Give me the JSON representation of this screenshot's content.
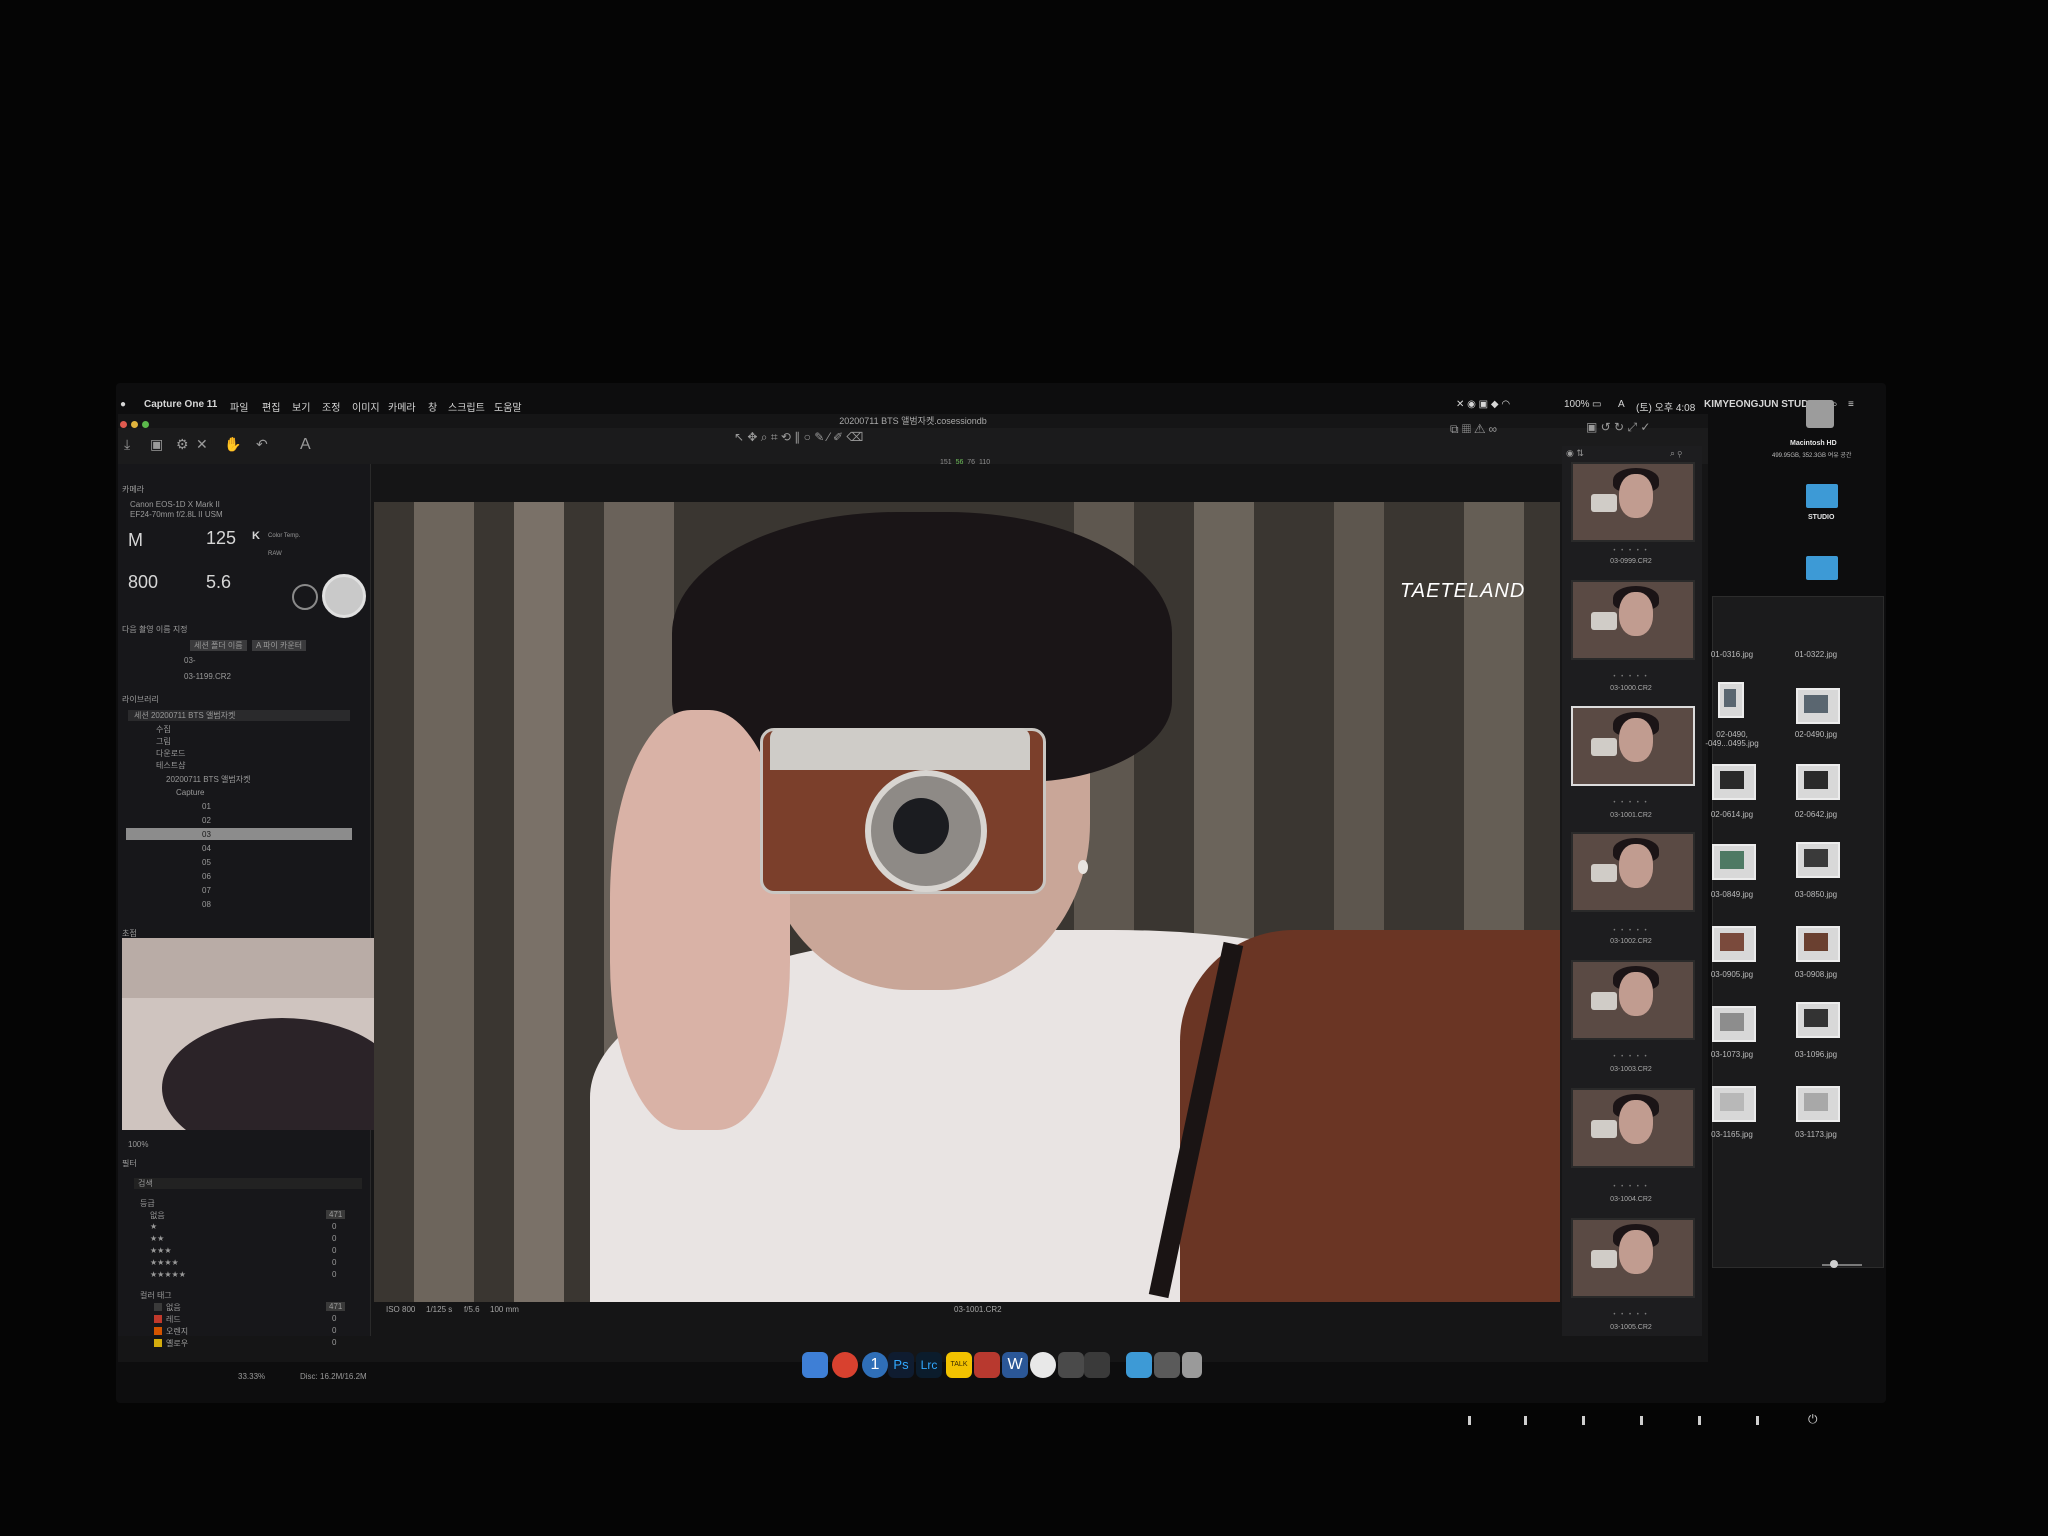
{
  "menubar": {
    "app_name": "Capture One 11",
    "items": [
      "파일",
      "편집",
      "보기",
      "조정",
      "이미지",
      "카메라",
      "창",
      "스크립트",
      "도움말"
    ],
    "battery": "100%",
    "clock": "(토) 오후 4:08",
    "studio": "KIMYEONGJUN STUDIO"
  },
  "window": {
    "title": "20200711 BTS 앨범자켓.cosessiondb"
  },
  "toolbar": {
    "font_tool": "A",
    "histogram_values": [
      "151",
      "56",
      "76",
      "110"
    ]
  },
  "left_panel": {
    "camera_section": {
      "header": "카메라",
      "model": "Canon EOS-1D X Mark II",
      "lens": "EF24-70mm f/2.8L II USM",
      "mode": "M",
      "shutter": "125",
      "iso": "800",
      "aperture": "5.6",
      "wb_letter": "K",
      "wb_label": "Color Temp.",
      "format": "RAW"
    },
    "capture_naming": {
      "header": "다음 촬영 이름 지정",
      "format_value": "세션 폴더 이름",
      "counter_value": "A 파이 카운터",
      "name_value": "03-",
      "sample": "03-1199.CR2"
    },
    "library": {
      "header": "라이브러리",
      "session": "세션 20200711 BTS 앨범자켓",
      "folders": [
        "수집",
        "그림",
        "다운로드",
        "테스트샵",
        "20200711 BTS 앨범자켓",
        "Capture",
        "01",
        "02",
        "03",
        "04",
        "05",
        "06",
        "07",
        "08"
      ]
    },
    "focus": {
      "header": "초점",
      "zoom": "100%"
    },
    "filters": {
      "header": "필터",
      "search_placeholder": "검색",
      "rating_header": "등급",
      "rating_rows": [
        {
          "label": "없음",
          "count": "471"
        },
        {
          "label": "★",
          "count": "0"
        },
        {
          "label": "★★",
          "count": "0"
        },
        {
          "label": "★★★",
          "count": "0"
        },
        {
          "label": "★★★★",
          "count": "0"
        },
        {
          "label": "★★★★★",
          "count": "0"
        }
      ],
      "color_tag_header": "컬러 태그",
      "color_tag_rows": [
        {
          "label": "없음",
          "count": "471",
          "color": "#3a3a3a"
        },
        {
          "label": "레드",
          "count": "0",
          "color": "#c0392b"
        },
        {
          "label": "오렌지",
          "count": "0",
          "color": "#d35400"
        },
        {
          "label": "옐로우",
          "count": "0",
          "color": "#d4ac0d"
        }
      ]
    },
    "status": {
      "zoom": "33.33%",
      "disk": "Disc: 16.2M/16.2M"
    }
  },
  "viewer": {
    "iso": "ISO 800",
    "shutter": "1/125 s",
    "aperture": "f/5.6",
    "focal": "100 mm",
    "filename": "03-1001.CR2",
    "watermark": "TAETELAND"
  },
  "filmstrip": {
    "thumbs": [
      {
        "label": "03-0999.CR2",
        "selected": false
      },
      {
        "label": "03-1000.CR2",
        "selected": false
      },
      {
        "label": "03-1001.CR2",
        "selected": true
      },
      {
        "label": "03-1002.CR2",
        "selected": false
      },
      {
        "label": "03-1003.CR2",
        "selected": false
      },
      {
        "label": "03-1004.CR2",
        "selected": false
      },
      {
        "label": "03-1005.CR2",
        "selected": false
      }
    ],
    "dots": "• • • • •"
  },
  "desktop": {
    "drive_name": "Macintosh HD",
    "drive_info": "499.95GB, 352.3GB 여유 공간",
    "folder_name": "STUDIO"
  },
  "finder": {
    "files": [
      "01-0316.jpg",
      "01-0322.jpg",
      "02-0490,\n-049...0495.jpg",
      "02-0490.jpg",
      "02-0614.jpg",
      "02-0642.jpg",
      "03-0849.jpg",
      "03-0850.jpg",
      "03-0905.jpg",
      "03-0908.jpg",
      "03-1073.jpg",
      "03-1096.jpg",
      "03-1165.jpg",
      "03-1173.jpg"
    ]
  },
  "dock": {
    "icons": [
      "finder-icon",
      "chrome-icon",
      "1password-icon",
      "photoshop-icon",
      "lightroom-classic-icon",
      "kakaotalk-icon",
      "photo-booth-icon",
      "word-icon",
      "wacom-icon",
      "tools-icon",
      "tools-icon",
      "downloads-folder-icon",
      "documents-icon",
      "trash-icon"
    ],
    "ps": "Ps",
    "lrc": "Lrc",
    "talk": "TALK",
    "w": "W",
    "one": "1"
  }
}
